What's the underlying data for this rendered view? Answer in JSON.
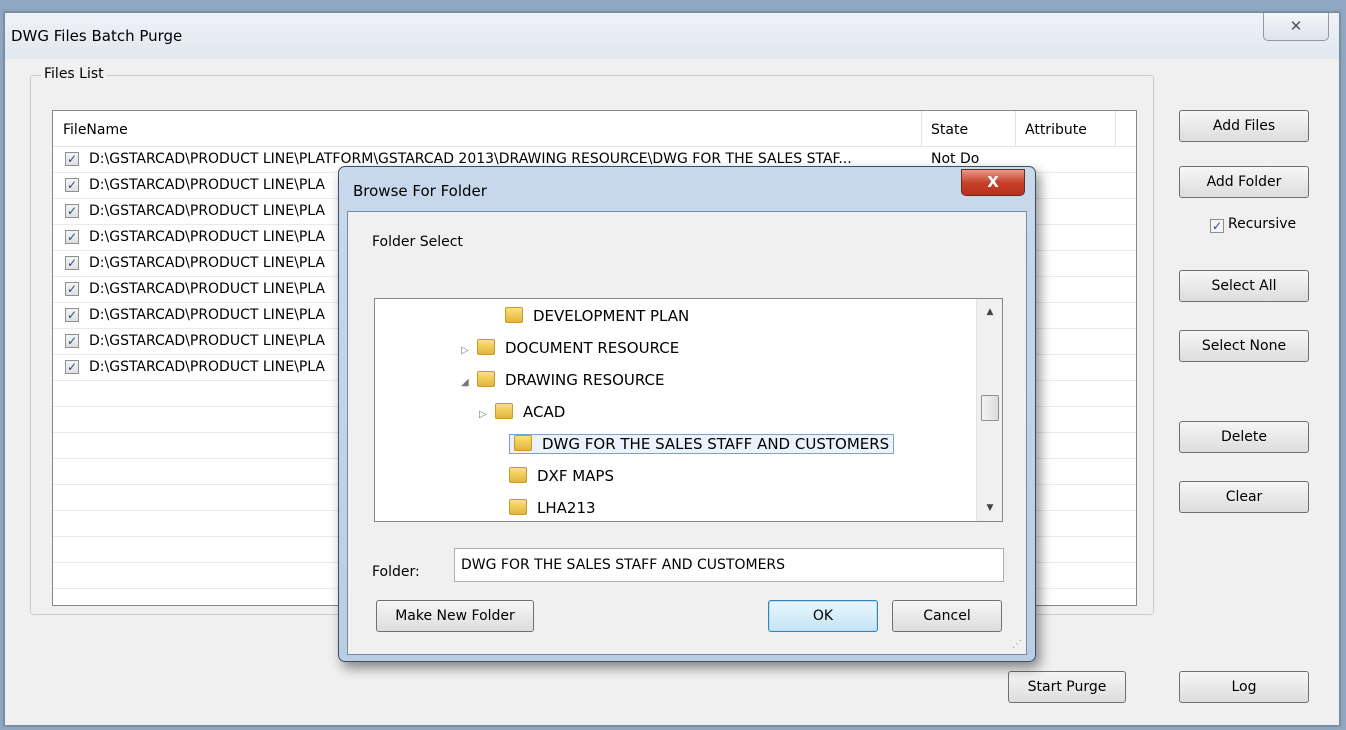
{
  "window": {
    "title": "DWG Files Batch Purge",
    "close_glyph": "✕"
  },
  "files_list": {
    "group_label": "Files List",
    "columns": [
      "FileName",
      "State",
      "Attribute"
    ],
    "rows": [
      {
        "checked": true,
        "filename": "D:\\GSTARCAD\\PRODUCT LINE\\PLATFORM\\GSTARCAD 2013\\DRAWING RESOURCE\\DWG FOR THE SALES STAF...",
        "state": "Not Do"
      },
      {
        "checked": true,
        "filename": "D:\\GSTARCAD\\PRODUCT LINE\\PLA",
        "state": ""
      },
      {
        "checked": true,
        "filename": "D:\\GSTARCAD\\PRODUCT LINE\\PLA",
        "state": ""
      },
      {
        "checked": true,
        "filename": "D:\\GSTARCAD\\PRODUCT LINE\\PLA",
        "state": ""
      },
      {
        "checked": true,
        "filename": "D:\\GSTARCAD\\PRODUCT LINE\\PLA",
        "state": ""
      },
      {
        "checked": true,
        "filename": "D:\\GSTARCAD\\PRODUCT LINE\\PLA",
        "state": ""
      },
      {
        "checked": true,
        "filename": "D:\\GSTARCAD\\PRODUCT LINE\\PLA",
        "state": ""
      },
      {
        "checked": true,
        "filename": "D:\\GSTARCAD\\PRODUCT LINE\\PLA",
        "state": ""
      },
      {
        "checked": true,
        "filename": "D:\\GSTARCAD\\PRODUCT LINE\\PLA",
        "state": ""
      }
    ]
  },
  "side_buttons": {
    "add_files": "Add Files",
    "add_folder": "Add Folder",
    "recursive_label": "Recursive",
    "recursive_checked": true,
    "select_all": "Select All",
    "select_none": "Select None",
    "delete": "Delete",
    "clear": "Clear",
    "log": "Log"
  },
  "start_purge": "Start Purge",
  "dialog": {
    "title": "Browse For Folder",
    "close_glyph": "X",
    "folder_select_label": "Folder Select",
    "tree": [
      {
        "label": "DEVELOPMENT PLAN",
        "arrow": ""
      },
      {
        "label": "DOCUMENT RESOURCE",
        "arrow": "▷"
      },
      {
        "label": "DRAWING RESOURCE",
        "arrow": "◢"
      },
      {
        "label": "ACAD",
        "arrow": "▷"
      },
      {
        "label": "DWG FOR THE SALES STAFF AND CUSTOMERS",
        "arrow": "",
        "selected": true
      },
      {
        "label": "DXF MAPS",
        "arrow": ""
      },
      {
        "label": "LHA213",
        "arrow": ""
      }
    ],
    "folder_label": "Folder:",
    "folder_value": "DWG FOR THE SALES STAFF AND CUSTOMERS",
    "make_new_folder": "Make New Folder",
    "ok": "OK",
    "cancel": "Cancel"
  },
  "colors": {
    "dialog_close_red": "#c7412a",
    "selection_border": "#7da2ce",
    "folder_yellow": "#e3b33a"
  }
}
